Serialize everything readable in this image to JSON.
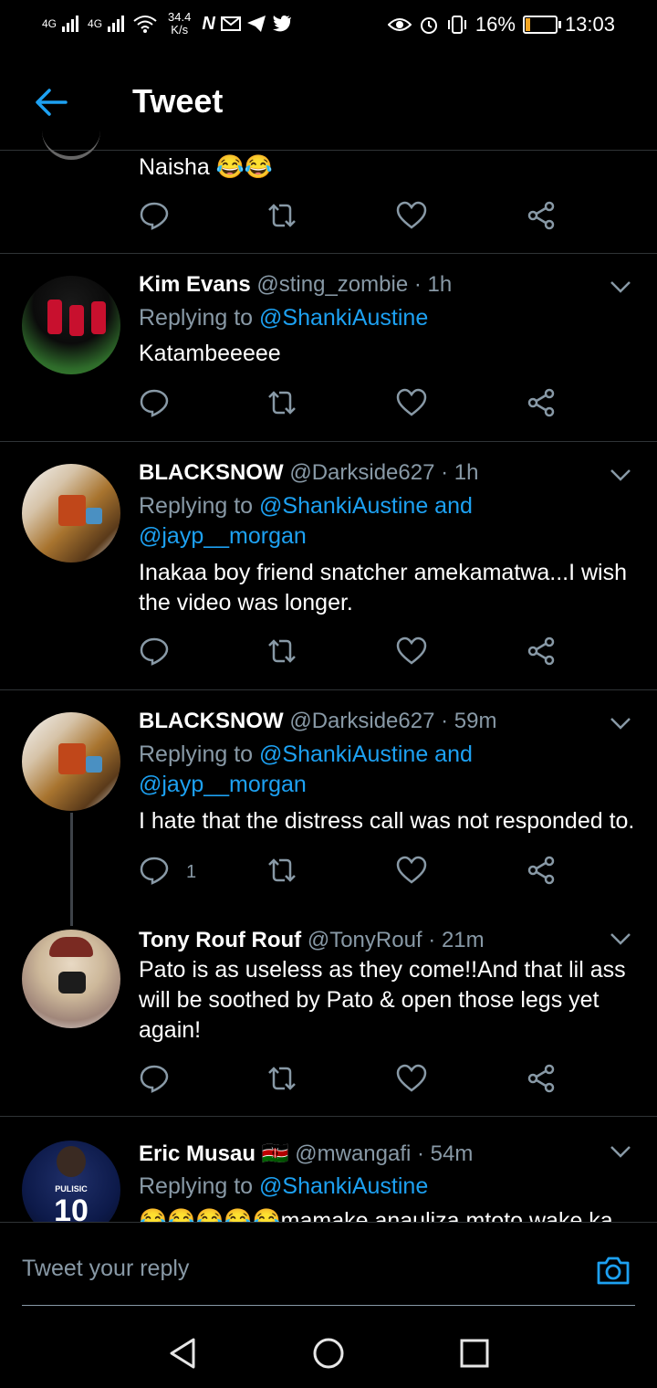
{
  "status_bar": {
    "network_1": "4G",
    "network_2": "4G",
    "speed_value": "34.4",
    "speed_unit": "K/s",
    "battery": "16%",
    "time": "13:03",
    "battery_level": 0.16,
    "icons": [
      "signal-icon",
      "wifi-icon",
      "netflix-icon",
      "gmail-icon",
      "telegram-icon",
      "twitter-icon",
      "eye-icon",
      "alarm-icon",
      "vibrate-icon",
      "battery-icon"
    ]
  },
  "header": {
    "title": "Tweet"
  },
  "tweets": [
    {
      "text": "Naisha 😂😂"
    },
    {
      "name": "Kim Evans",
      "handle": "@sting_zombie",
      "time": "· 1h",
      "replying_prefix": "Replying to ",
      "replying_to": "@ShankiAustine",
      "text": "Katambeeeee"
    },
    {
      "name": "BLACKSNOW",
      "handle": "@Darkside627",
      "time": "· 1h",
      "replying_prefix": "Replying to ",
      "replying_to": "@ShankiAustine and",
      "replying_to_2": "@jayp__morgan",
      "text": "Inakaa boy friend snatcher amekamatwa...I wish the video was longer."
    },
    {
      "name": "BLACKSNOW",
      "handle": "@Darkside627",
      "time": "· 59m",
      "replying_prefix": "Replying to ",
      "replying_to": "@ShankiAustine and",
      "replying_to_2": "@jayp__morgan",
      "text": "I hate that the distress call was not responded to.",
      "reply_count": "1"
    },
    {
      "name": "Tony Rouf Rouf",
      "handle": "@TonyRouf",
      "time": "· 21m",
      "text": "Pato is as useless as they come!!And that lil ass will be soothed by Pato & open those legs yet again!"
    },
    {
      "name": "Eric Musau 🇰🇪",
      "handle": "@mwangafi",
      "time": "· 54m",
      "replying_prefix": "Replying to ",
      "replying_to": "@ShankiAustine",
      "text": "😂😂😂😂😂mamake anauliza mtoto wake ka",
      "avatar_jersey_name": "PULISIC",
      "avatar_jersey_number": "10"
    }
  ],
  "reply_bar": {
    "placeholder": "Tweet your reply"
  },
  "colors": {
    "accent": "#1da1f2",
    "muted": "#8899a6",
    "divider": "#2f3336",
    "background": "#000000"
  }
}
